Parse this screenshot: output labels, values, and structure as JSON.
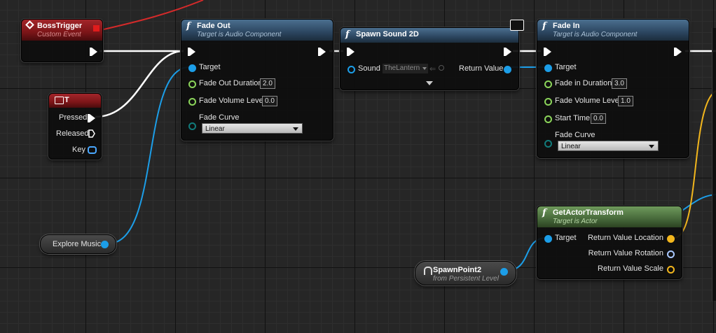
{
  "nodes": {
    "boss_trigger": {
      "title": "BossTrigger",
      "subtitle": "Custom Event"
    },
    "t_key": {
      "title": "T",
      "pressed": "Pressed",
      "released": "Released",
      "key": "Key"
    },
    "fade_out": {
      "title": "Fade Out",
      "subtitle": "Target is Audio Component",
      "target": "Target",
      "duration_label": "Fade Out Duration",
      "duration_value": "2.0",
      "volume_label": "Fade Volume Level",
      "volume_value": "0.0",
      "curve_label": "Fade Curve",
      "curve_value": "Linear"
    },
    "spawn_sound": {
      "title": "Spawn Sound 2D",
      "sound_label": "Sound",
      "sound_value": "TheLantern",
      "return_label": "Return Value"
    },
    "fade_in": {
      "title": "Fade In",
      "subtitle": "Target is Audio Component",
      "target": "Target",
      "duration_label": "Fade in Duration",
      "duration_value": "3.0",
      "volume_label": "Fade Volume Level",
      "volume_value": "1.0",
      "start_label": "Start Time",
      "start_value": "0.0",
      "curve_label": "Fade Curve",
      "curve_value": "Linear"
    },
    "explore_music": {
      "label": "Explore Music"
    },
    "spawn_point": {
      "title": "SpawnPoint2",
      "subtitle": "from Persistent Level"
    },
    "get_actor_transform": {
      "title": "GetActorTransform",
      "subtitle": "Target is Actor",
      "target": "Target",
      "location": "Return Value Location",
      "rotation": "Return Value Rotation",
      "scale": "Return Value Scale"
    }
  },
  "colors": {
    "exec_wire": "#ffffff",
    "object_wire": "#1c9ee8",
    "vector_wire": "#f2b61d",
    "delegate_wire": "#e02020"
  }
}
